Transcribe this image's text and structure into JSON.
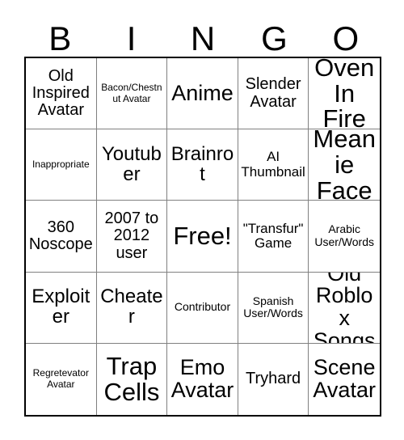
{
  "card": {
    "title": "BINGO",
    "headers": [
      "B",
      "I",
      "N",
      "G",
      "O"
    ],
    "columns": 5,
    "rows": 5,
    "free_space_index": 12,
    "colors": {
      "background": "#ffffff",
      "text": "#000000",
      "outer_border": "#000000",
      "grid_line": "#808080"
    },
    "cells": [
      {
        "text": "Old Inspired Avatar",
        "size": "fs-md"
      },
      {
        "text": "Bacon/Chestnut Avatar",
        "size": "fs-xxs"
      },
      {
        "text": "Anime",
        "size": "fs-xl"
      },
      {
        "text": "Slender Avatar",
        "size": "fs-md"
      },
      {
        "text": "Oven In Fire",
        "size": "fs-xxl"
      },
      {
        "text": "Inappropriate",
        "size": "fs-xxs"
      },
      {
        "text": "Youtuber",
        "size": "fs-lg"
      },
      {
        "text": "Brainrot",
        "size": "fs-lg"
      },
      {
        "text": "AI Thumbnail",
        "size": "fs-sm"
      },
      {
        "text": "Meanie Face",
        "size": "fs-xxl"
      },
      {
        "text": "360 Noscope",
        "size": "fs-md"
      },
      {
        "text": "2007 to 2012 user",
        "size": "fs-md"
      },
      {
        "text": "Free!",
        "size": "fs-xxl"
      },
      {
        "text": "\"Transfur\" Game",
        "size": "fs-sm"
      },
      {
        "text": "Arabic User/Words",
        "size": "fs-xs"
      },
      {
        "text": "Exploiter",
        "size": "fs-lg"
      },
      {
        "text": "Cheater",
        "size": "fs-lg"
      },
      {
        "text": "Contributor",
        "size": "fs-xs"
      },
      {
        "text": "Spanish User/Words",
        "size": "fs-xs"
      },
      {
        "text": "Old Roblox Songs",
        "size": "fs-xl"
      },
      {
        "text": "Regretevator Avatar",
        "size": "fs-xxs"
      },
      {
        "text": "Trap Cells",
        "size": "fs-xxl"
      },
      {
        "text": "Emo Avatar",
        "size": "fs-xl"
      },
      {
        "text": "Tryhard",
        "size": "fs-md"
      },
      {
        "text": "Scene Avatar",
        "size": "fs-xl"
      }
    ]
  }
}
